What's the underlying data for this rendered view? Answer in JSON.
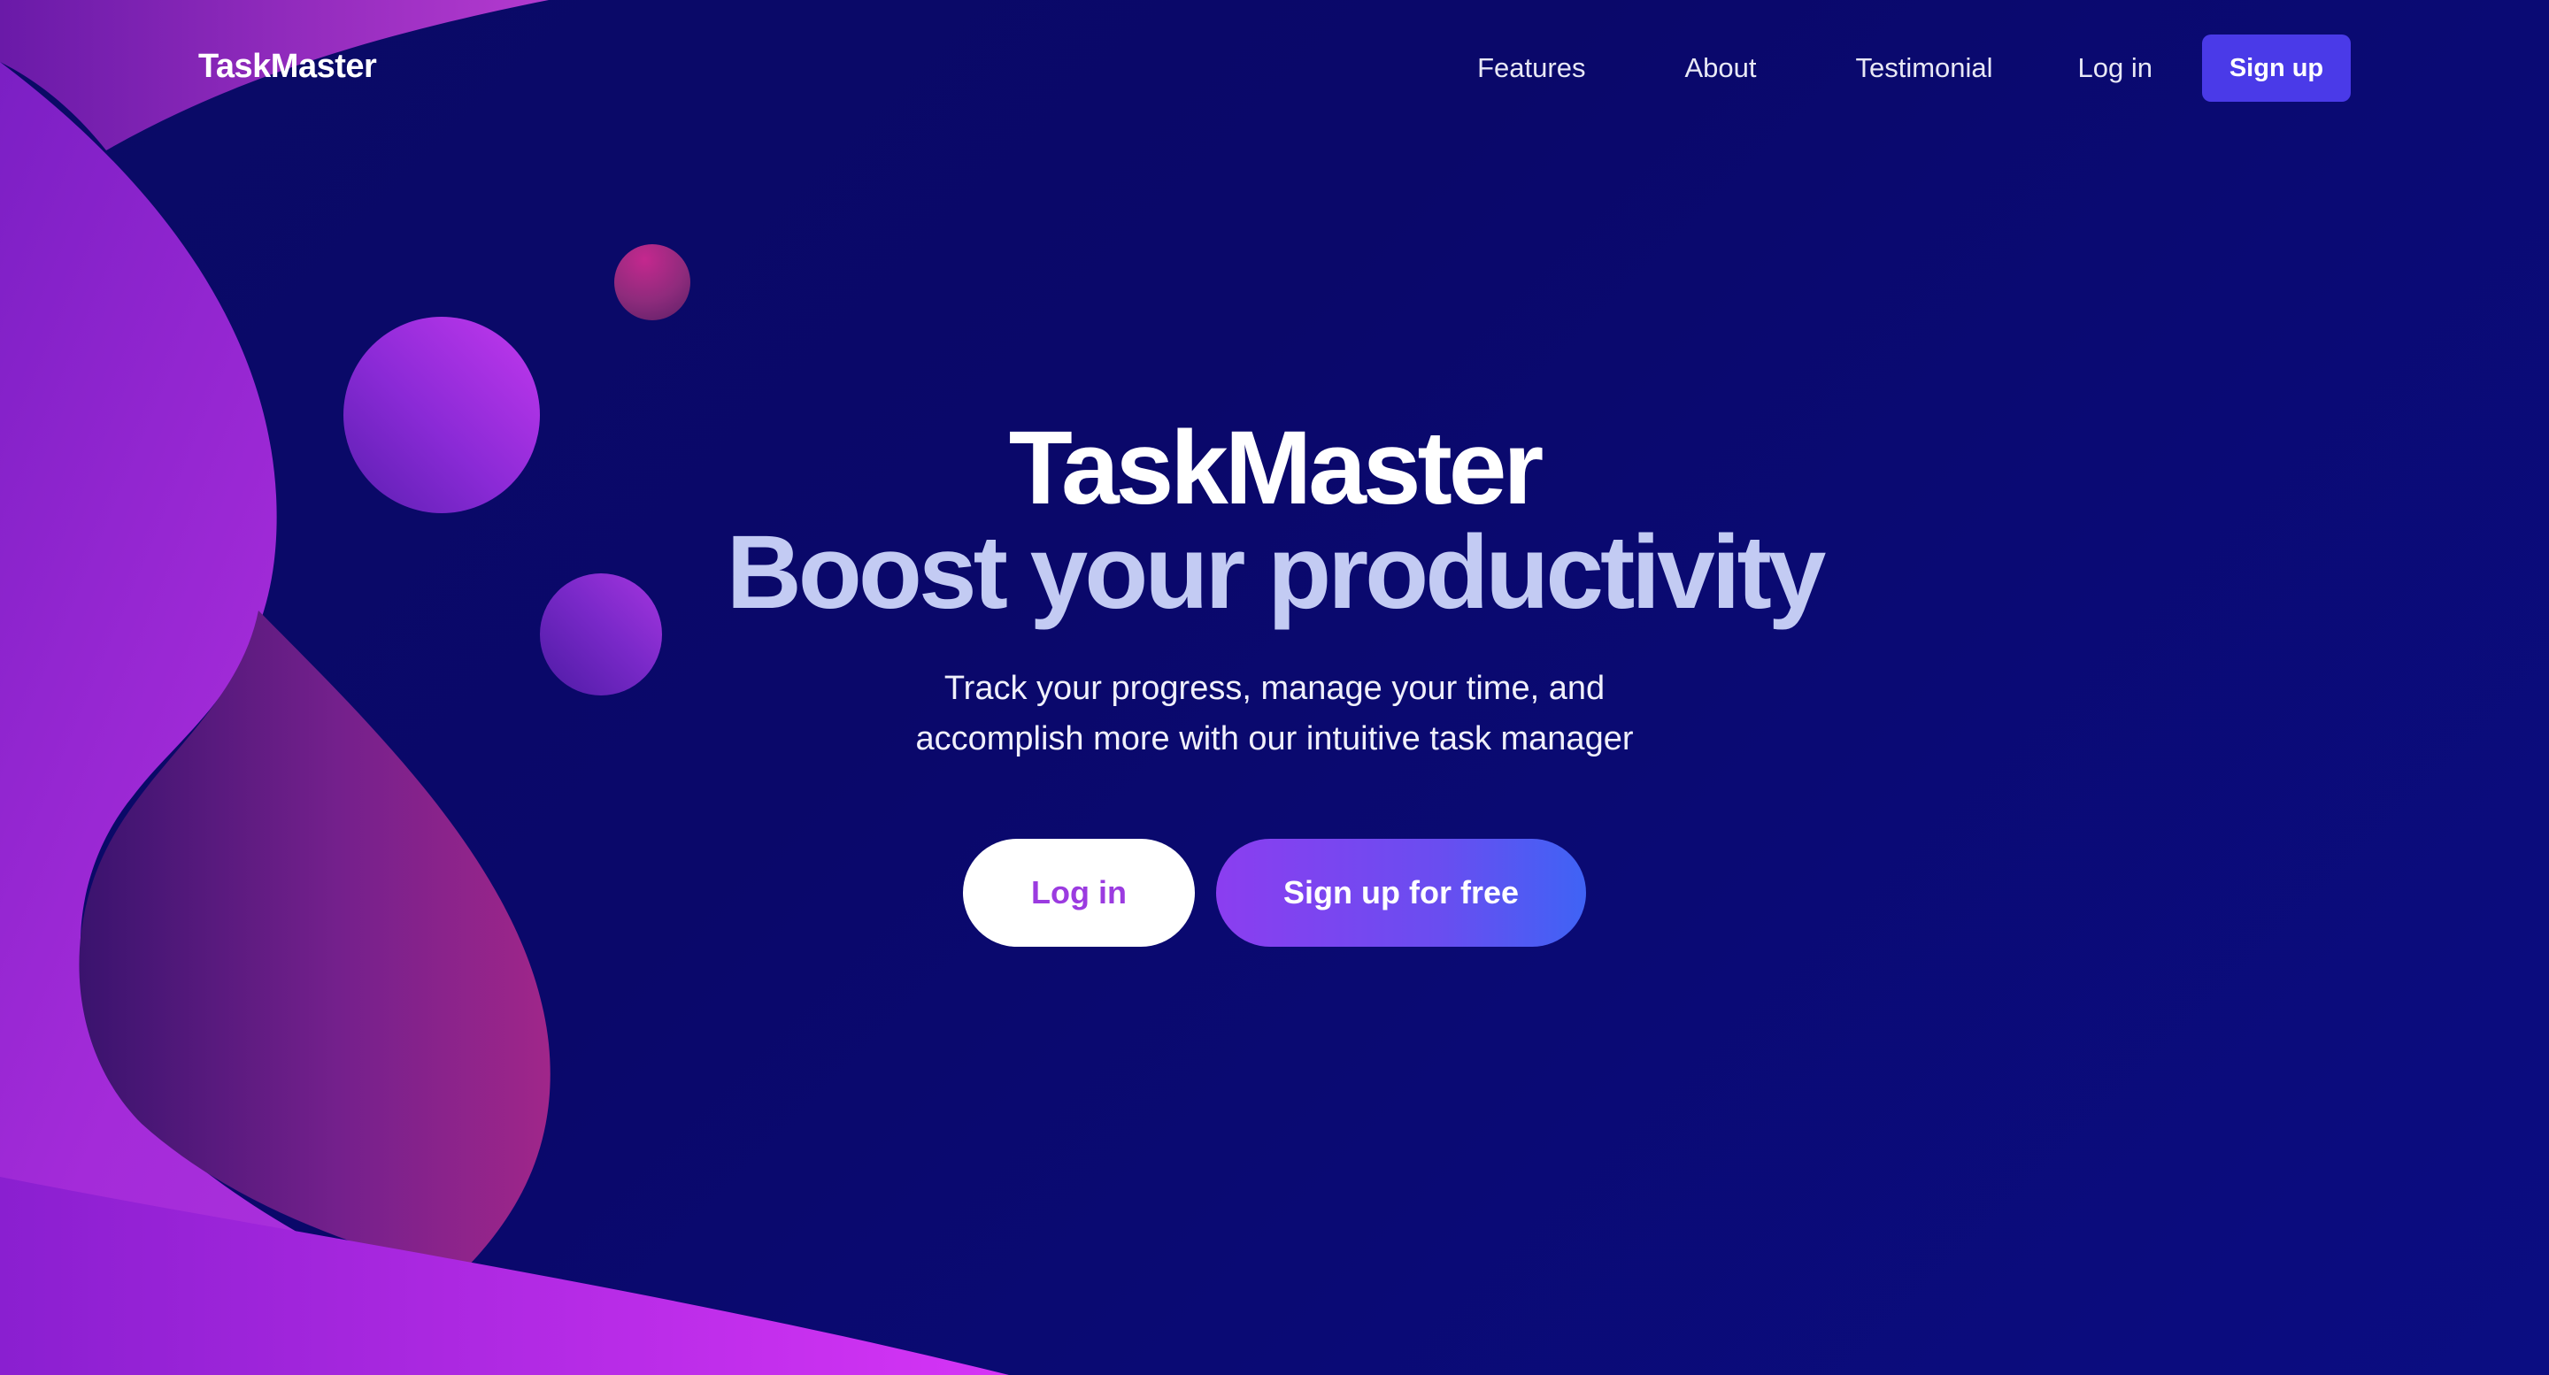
{
  "nav": {
    "brand": "TaskMaster",
    "links": [
      {
        "label": "Features"
      },
      {
        "label": "About"
      },
      {
        "label": "Testimonial"
      },
      {
        "label": "Log in"
      }
    ],
    "signup_label": "Sign up",
    "signup_color": "#4a3ae8"
  },
  "hero": {
    "title": "TaskMaster",
    "subtitle": "Boost your productivity",
    "description": "Track your progress, manage your time, and accomplish more with our intuitive task manager",
    "login_label": "Log in",
    "signup_label": "Sign up for free"
  },
  "colors": {
    "background": "#0a0a66",
    "subtitle": "#c3cbf3",
    "accent_purple": "#9b3be0",
    "accent_blue": "#3f63f5",
    "wave_magenta": "#d12ff0"
  }
}
